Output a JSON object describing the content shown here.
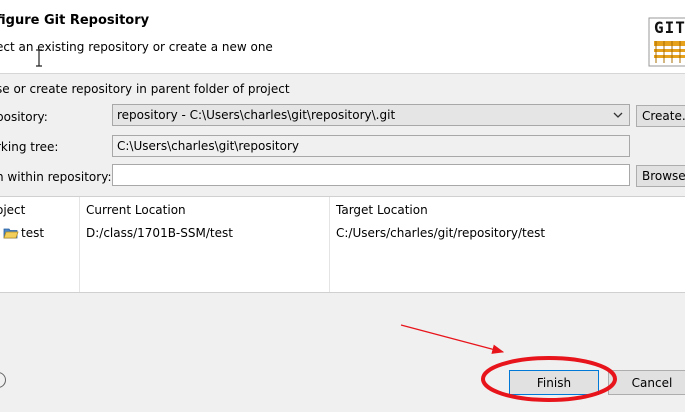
{
  "dialog": {
    "title": "figure Git Repository",
    "subtitle": "ect an existing repository or create a new one",
    "logo_text": "GIT"
  },
  "form": {
    "checkbox_label": "se or create repository in parent folder of project",
    "repository_label": "pository:",
    "repository_value": "repository - C:\\Users\\charles\\git\\repository\\.git",
    "create_button": "Create...",
    "working_tree_label": "rking tree:",
    "working_tree_value": "C:\\Users\\charles\\git\\repository",
    "path_label": "h within repository:",
    "path_value": "",
    "browse_button": "Browse"
  },
  "table": {
    "headers": [
      "oject",
      "Current Location",
      "Target Location"
    ],
    "rows": [
      {
        "project": "test",
        "current": "D:/class/1701B-SSM/test",
        "target": "C:/Users/charles/git/repository/test"
      }
    ]
  },
  "footer": {
    "finish_button": "Finish",
    "cancel_button": "Cancel"
  },
  "colors": {
    "annotation": "#e8141b",
    "focus_border": "#0078d7"
  }
}
